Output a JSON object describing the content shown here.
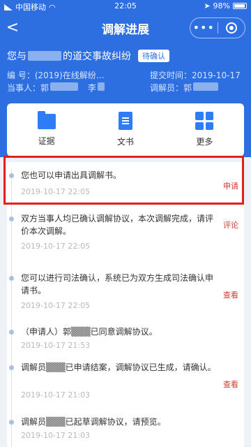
{
  "status_bar": {
    "carrier": "中国移动",
    "time": "22:05",
    "battery": "98%"
  },
  "nav": {
    "title": "调解进展",
    "more": "•••"
  },
  "case": {
    "title_prefix": "您与",
    "title_suffix": "的道交事故纠纷",
    "status": "待确认",
    "number_label": "编  号：",
    "number_value": "(2019)在线解纷…",
    "submit_label": "提交时间：",
    "submit_value": "2019-10-17",
    "party_label": "当事人：",
    "party_a": "郭",
    "party_b": "李",
    "mediator_label": "调解员：",
    "mediator_value": "郭"
  },
  "tools": [
    {
      "label": "证据",
      "icon": "folder-icon"
    },
    {
      "label": "文书",
      "icon": "document-icon"
    },
    {
      "label": "更多",
      "icon": "grid-icon"
    }
  ],
  "timeline": [
    {
      "text": "您也可以申请出具调解书。",
      "time": "2019-10-17 22:05",
      "action": "申请"
    },
    {
      "text": "双方当事人均已确认调解协议，本次调解完成，请评价本次调解。",
      "time": "2019-10-17 22:05",
      "action": "评论"
    },
    {
      "text": "您可以进行司法确认，系统已为双方生成司法确认申请书。",
      "time": "2019-10-17 22:05",
      "action": "查看"
    },
    {
      "text": "（申请人）郭▒▒▒已同意调解协议。",
      "time": "2019-10-17 21:53",
      "action": ""
    },
    {
      "text": "调解员▒▒▒已申请结案，调解协议已生成，请确认。",
      "time": "2019-10-17 21:03",
      "action": "查看"
    },
    {
      "text": "调解员▒▒▒已起草调解协议，请预览。",
      "time": "2019-10-17 21:03",
      "action": ""
    }
  ]
}
